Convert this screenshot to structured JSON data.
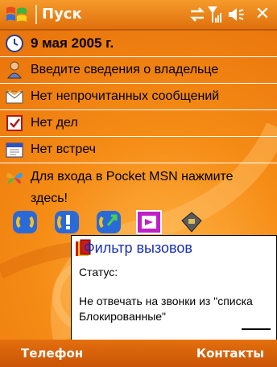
{
  "titlebar": {
    "title": "Пуск"
  },
  "today": {
    "date": "9 мая 2005 г.",
    "owner": "Введите сведения о владельце",
    "messages": "Нет непрочитанных сообщений",
    "tasks": "Нет дел",
    "appointments": "Нет встреч",
    "msn": "Для входа в Pocket MSN нажмите здесь!"
  },
  "notification": {
    "title": "Фильтр вызовов",
    "status_label": "Статус:",
    "message": "Не отвечать на  звонки из \"списка Блокированные\""
  },
  "menubar": {
    "left": "Телефон",
    "right": "Контакты"
  },
  "colors": {
    "theme_orange": "#f08a1c",
    "bubble_title_blue": "#1a2fb5"
  }
}
